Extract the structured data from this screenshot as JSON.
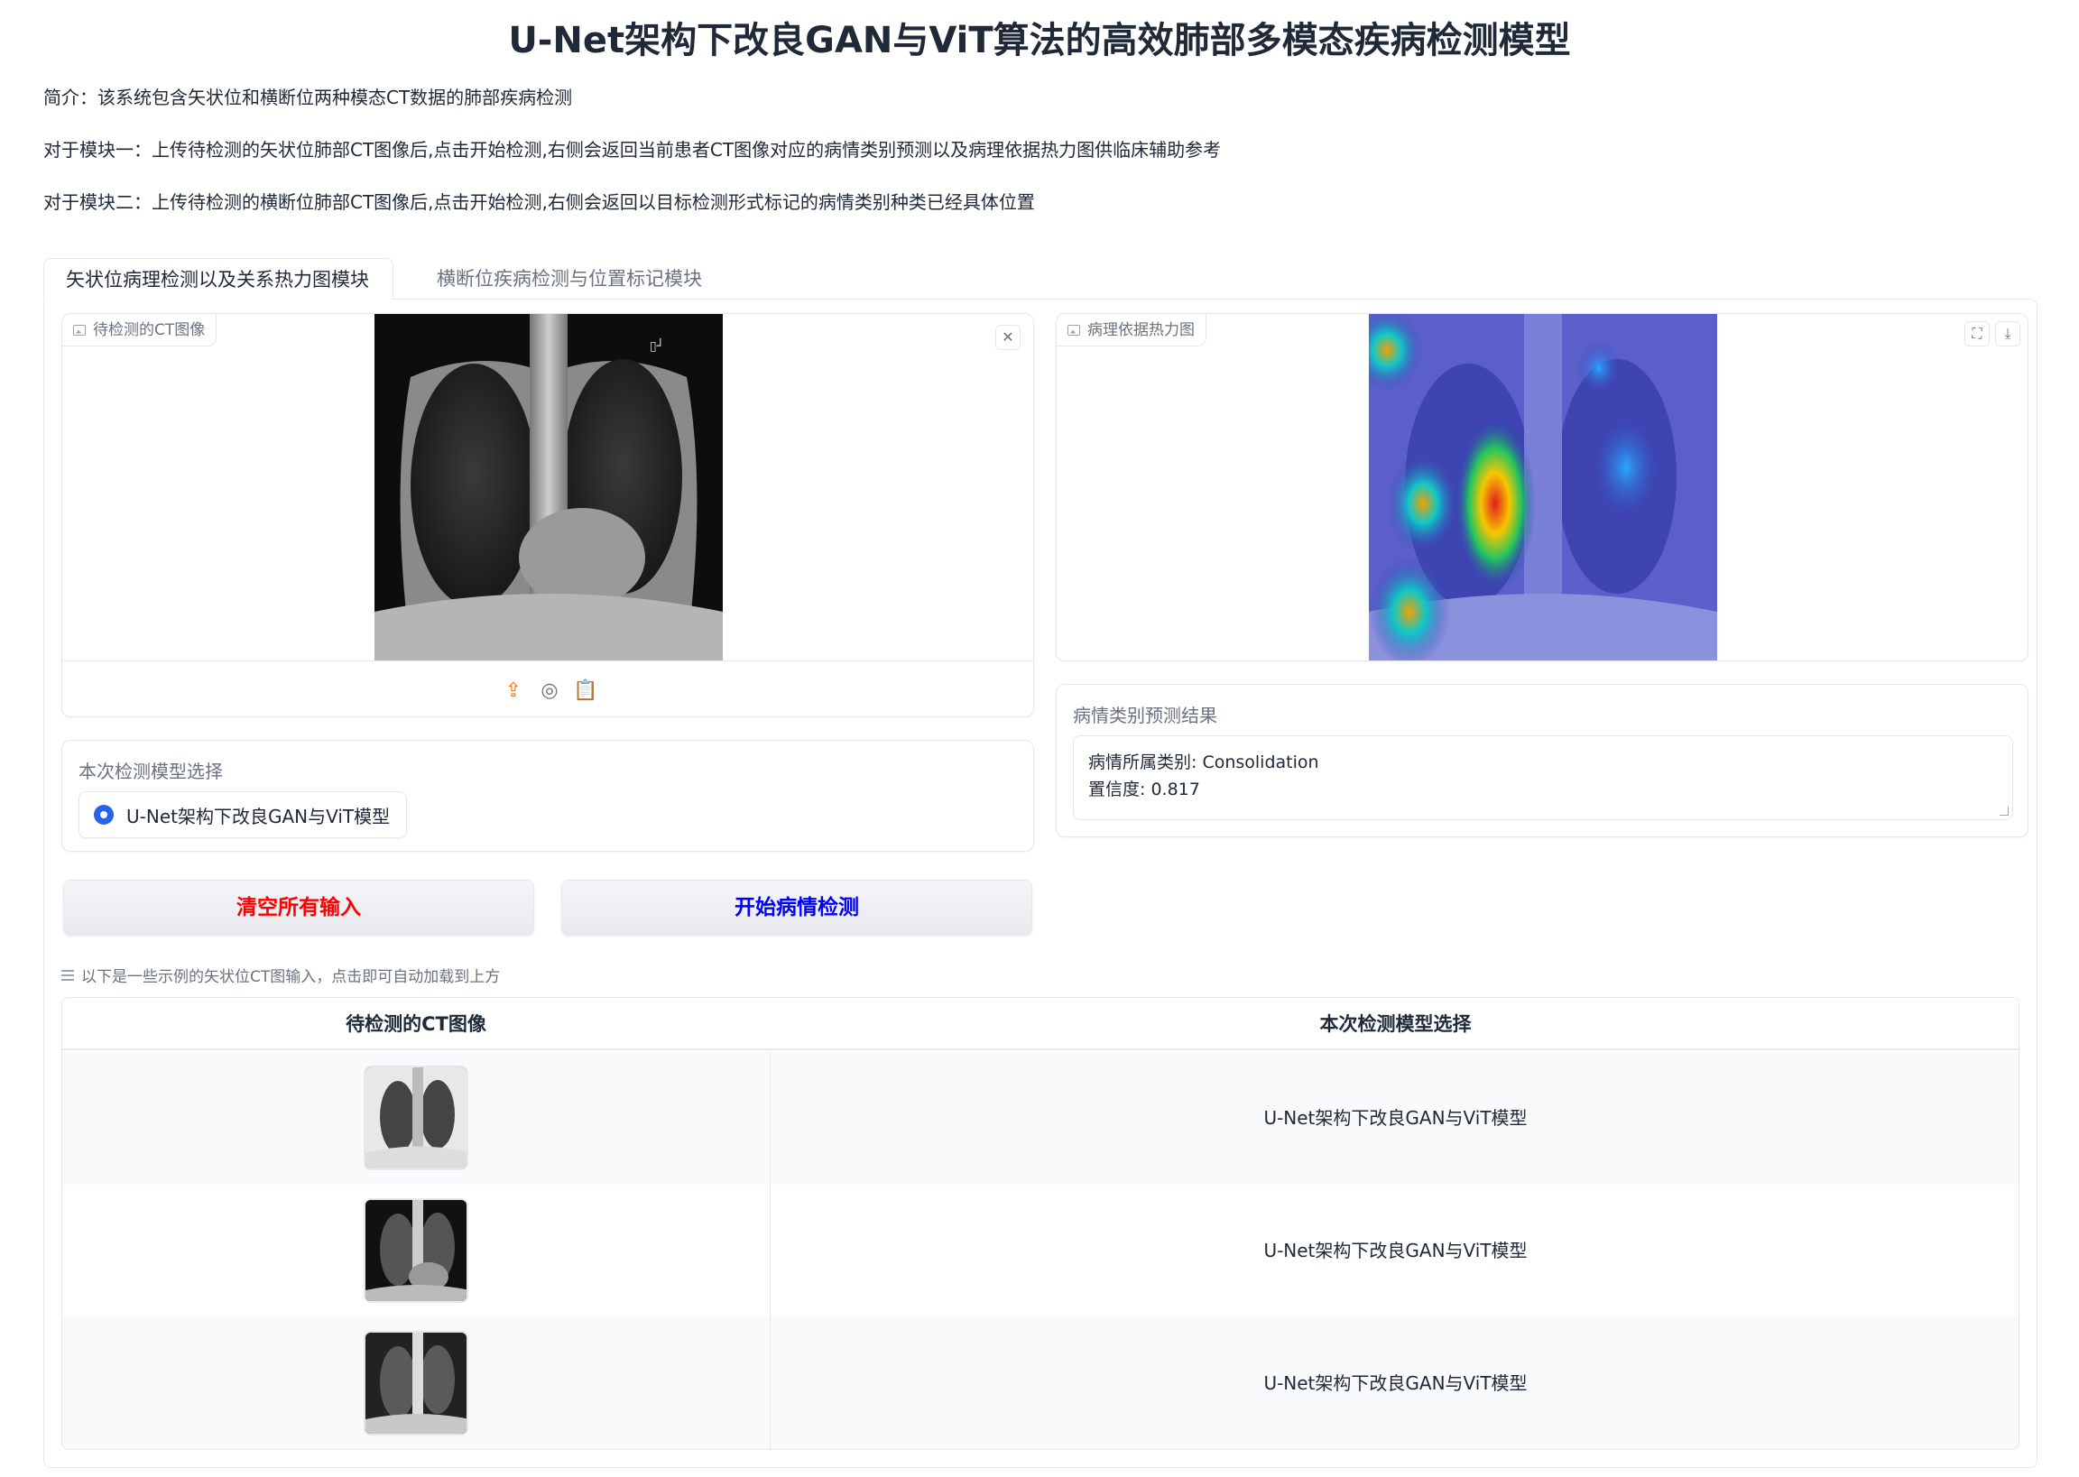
{
  "page": {
    "title": "U-Net架构下改良GAN与ViT算法的高效肺部多模态疾病检测模型",
    "intro": "简介：该系统包含矢状位和横断位两种模态CT数据的肺部疾病检测",
    "module1": "对于模块一：上传待检测的矢状位肺部CT图像后,点击开始检测,右侧会返回当前患者CT图像对应的病情类别预测以及病理依据热力图供临床辅助参考",
    "module2": "对于模块二：上传待检测的横断位肺部CT图像后,点击开始检测,右侧会返回以目标检测形式标记的病情类别种类已经具体位置"
  },
  "tabs": [
    {
      "label": "矢状位病理检测以及关系热力图模块",
      "active": true
    },
    {
      "label": "横断位疾病检测与位置标记模块",
      "active": false
    }
  ],
  "input_image": {
    "label": "待检测的CT图像",
    "clear_icon": "close-icon",
    "tools": [
      "upload-icon",
      "webcam-icon",
      "clipboard-icon"
    ]
  },
  "heatmap": {
    "label": "病理依据热力图",
    "icons": [
      "fullscreen-icon",
      "download-icon"
    ]
  },
  "model_select": {
    "label": "本次检测模型选择",
    "selected": "U-Net架构下改良GAN与ViT模型"
  },
  "result": {
    "label": "病情类别预测结果",
    "line1": "病情所属类别: Consolidation",
    "line2": "置信度: 0.817"
  },
  "buttons": {
    "clear": "清空所有输入",
    "start": "开始病情检测",
    "clear_color": "#ff0000",
    "start_color": "#0000ff"
  },
  "examples": {
    "label": "以下是一些示例的矢状位CT图输入，点击即可自动加载到上方",
    "headers": [
      "待检测的CT图像",
      "本次检测模型选择"
    ],
    "rows": [
      {
        "model": "U-Net架构下改良GAN与ViT模型"
      },
      {
        "model": "U-Net架构下改良GAN与ViT模型"
      },
      {
        "model": "U-Net架构下改良GAN与ViT模型"
      }
    ]
  },
  "colors": {
    "accent": "#2563eb",
    "border": "#e5e7eb",
    "muted": "#6b7280"
  }
}
